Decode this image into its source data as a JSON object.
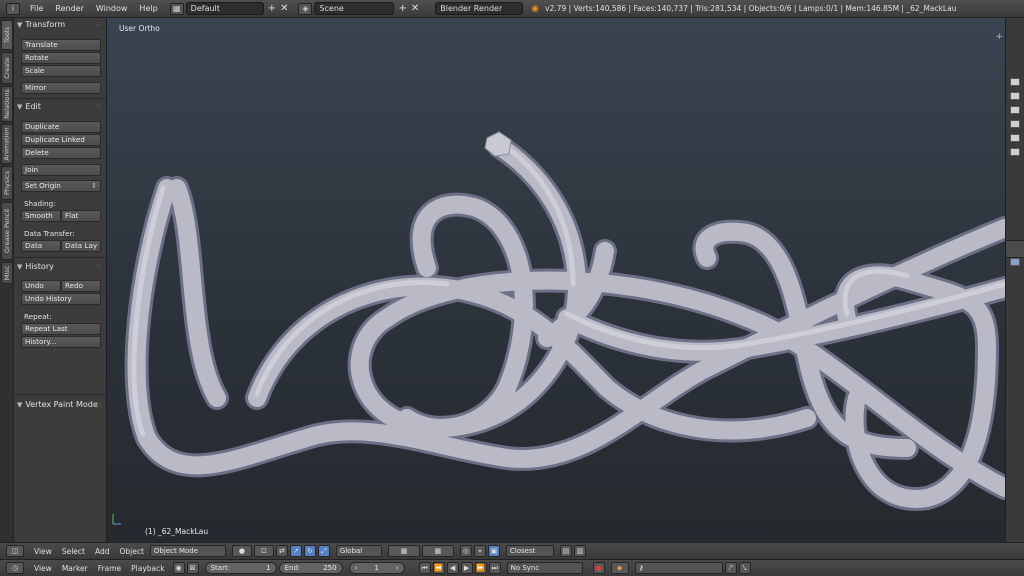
{
  "topbar": {
    "menus": [
      "File",
      "Render",
      "Window",
      "Help"
    ],
    "layout": "Default",
    "scene": "Scene",
    "engine": "Blender Render",
    "stats": "v2.79 | Verts:140,586 | Faces:140,737 | Tris:281,534 | Objects:0/6 | Lamps:0/1 | Mem:146.85M | _62_MackLau"
  },
  "tabs": [
    "Tools",
    "Create",
    "Relations",
    "Animation",
    "Physics",
    "Grease Pencil",
    "Misc"
  ],
  "shelf": {
    "transform": {
      "title": "Transform",
      "buttons": [
        "Translate",
        "Rotate",
        "Scale",
        "Mirror"
      ]
    },
    "edit": {
      "title": "Edit",
      "buttons": [
        "Duplicate",
        "Duplicate Linked",
        "Delete",
        "Join",
        "Set Origin"
      ],
      "shading_label": "Shading:",
      "smooth": "Smooth",
      "flat": "Flat",
      "data_transfer_label": "Data Transfer:",
      "data": "Data",
      "data_lay": "Data Lay"
    },
    "history": {
      "title": "History",
      "undo": "Undo",
      "redo": "Redo",
      "undo_history": "Undo History",
      "repeat_label": "Repeat:",
      "repeat_last": "Repeat Last",
      "history": "History..."
    },
    "vertex_paint": "Vertex Paint Mode"
  },
  "viewport": {
    "title": "User Ortho",
    "object": "(1) _62_MackLau"
  },
  "header3d": {
    "menus": [
      "View",
      "Select",
      "Add",
      "Object"
    ],
    "mode": "Object Mode",
    "orientation": "Global",
    "snap": "Closest"
  },
  "timeline": {
    "menus": [
      "View",
      "Marker",
      "Frame",
      "Playback"
    ],
    "start_label": "Start:",
    "start": "1",
    "end_label": "End:",
    "end": "250",
    "frame": "1",
    "sync": "No Sync"
  },
  "colors": {
    "accent": "#5680c2",
    "tube": "#b9bac6"
  }
}
